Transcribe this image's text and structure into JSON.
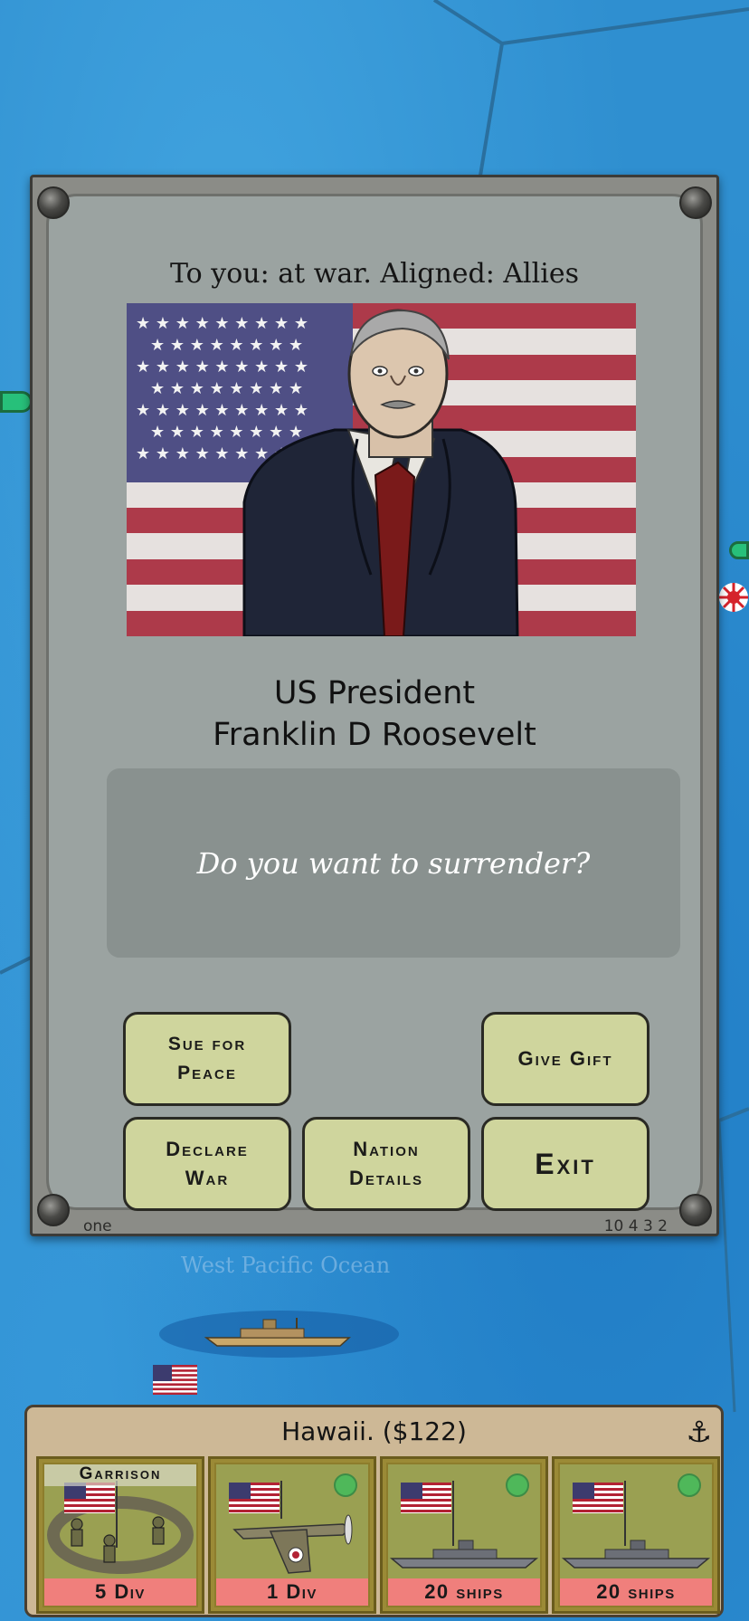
{
  "dialog": {
    "relation_text": "To you: at war.  Aligned: Allies",
    "leader_role": "US President",
    "leader_name": "Franklin D Roosevelt",
    "message": "Do you want to surrender?",
    "buttons": {
      "sue_for_peace": "Sue for\nPeace",
      "give_gift": "Give Gift",
      "declare_war": "Declare\nWar",
      "nation_details": "Nation\nDetails",
      "exit": "Exit"
    },
    "footer_left": "one",
    "footer_right": "10 4 3 2"
  },
  "map": {
    "region_label": "West Pacific Ocean"
  },
  "territory_panel": {
    "title": "Hawaii. ($122)",
    "icon": "anchor-icon",
    "units": [
      {
        "tag": "Garrison",
        "label": "5 Div",
        "type": "garrison"
      },
      {
        "label": "1 Div",
        "type": "air"
      },
      {
        "label": "20 ships",
        "type": "navy"
      },
      {
        "label": "20 ships",
        "type": "navy"
      }
    ]
  },
  "colors": {
    "ocean": "#2f8fd0",
    "button_fill": "#cfd59d",
    "dialog_panel": "#9ba3a1",
    "unit_label": "#f07f7c",
    "panel_bg": "#cdb896"
  }
}
